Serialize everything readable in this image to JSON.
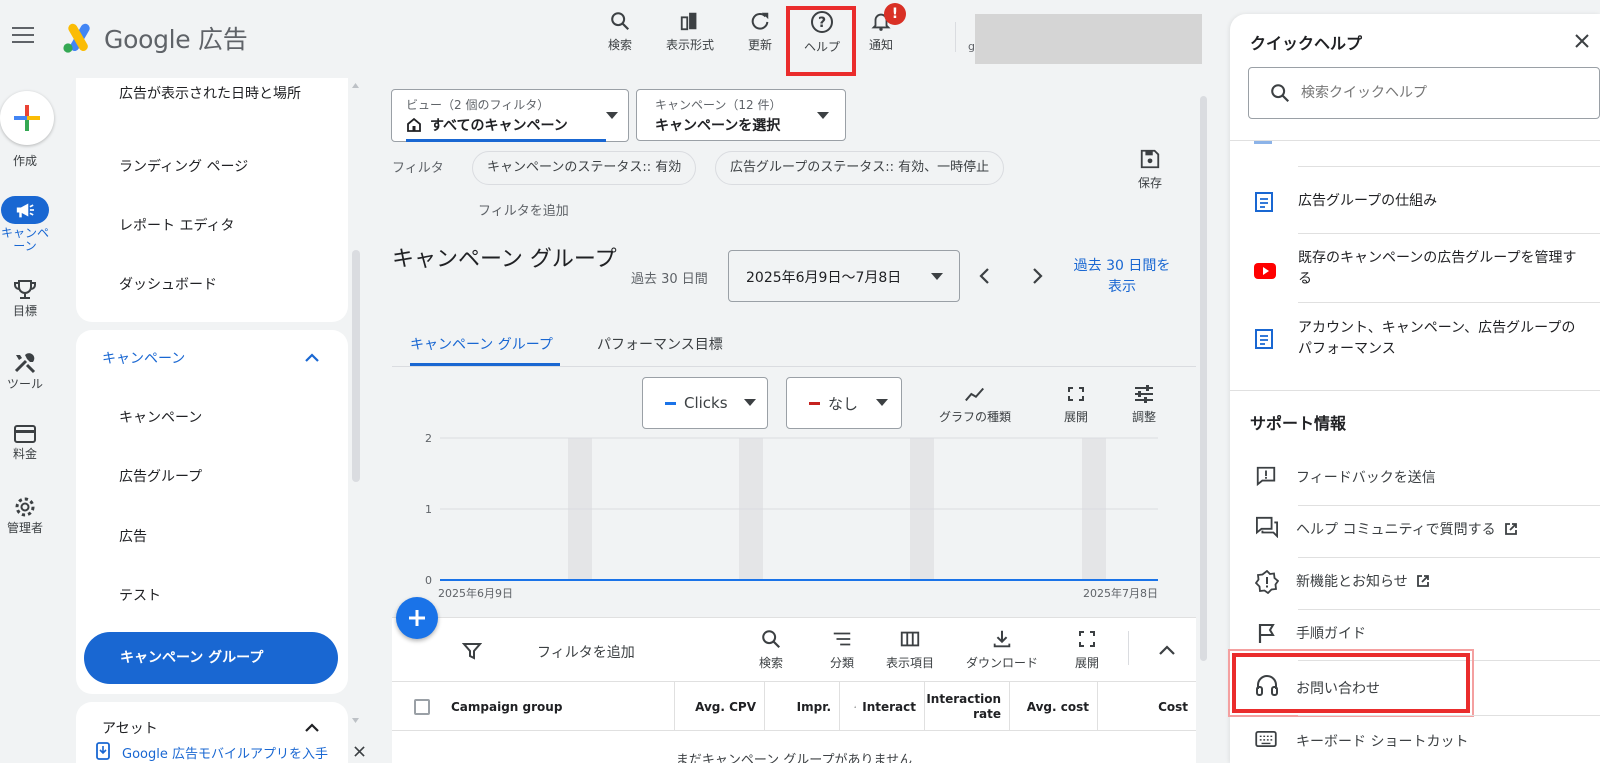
{
  "header": {
    "app_name": "Google 広告",
    "tools": [
      {
        "label": "検索",
        "icon": "search-icon"
      },
      {
        "label": "表示形式",
        "icon": "appearance-icon"
      },
      {
        "label": "更新",
        "icon": "refresh-icon"
      },
      {
        "label": "ヘルプ",
        "icon": "help-icon"
      },
      {
        "label": "通知",
        "icon": "bell-icon"
      }
    ],
    "notification_badge": "!",
    "account_initial": "g"
  },
  "rail": {
    "create_label": "作成",
    "items": [
      {
        "label": "キャンペーン",
        "icon": "megaphone-icon"
      },
      {
        "label": "目標",
        "icon": "trophy-icon"
      },
      {
        "label": "ツール",
        "icon": "tools-icon"
      },
      {
        "label": "料金",
        "icon": "credit-card-icon"
      },
      {
        "label": "管理者",
        "icon": "gear-icon"
      }
    ]
  },
  "nav": {
    "top_items": [
      "広告が表示された日時と場所",
      "ランディング ページ",
      "レポート エディタ",
      "ダッシュボード"
    ],
    "campaign_section": "キャンペーン",
    "campaign_items": [
      "キャンペーン",
      "広告グループ",
      "広告",
      "テスト"
    ],
    "selected_item": "キャンペーン グループ",
    "assets_section": "アセット",
    "mobile_app_text": "Google 広告モバイルアプリを入手"
  },
  "main": {
    "view_selector": {
      "small": "ビュー（2 個のフィルタ）",
      "main": "すべてのキャンペーン"
    },
    "campaign_selector": {
      "small": "キャンペーン（12 件）",
      "main": "キャンペーンを選択"
    },
    "filter_label": "フィルタ",
    "chips": [
      "キャンペーンのステータス:: 有効",
      "広告グループのステータス:: 有効、一時停止"
    ],
    "add_filter": "フィルタを追加",
    "save_label": "保存",
    "page_title": "キャンペーン グループ",
    "period_label": "過去 30 日間",
    "date_range": "2025年6月9日〜7月8日",
    "show_last_30": "過去 30 日間を表示",
    "tabs": [
      "キャンペーン グループ",
      "パフォーマンス目標"
    ]
  },
  "chart": {
    "metric1": "Clicks",
    "metric1_color": "#1a73e8",
    "metric2": "なし",
    "metric2_color": "#c5221f",
    "tools": [
      "グラフの種類",
      "展開",
      "調整"
    ]
  },
  "chart_data": {
    "type": "line",
    "x_labels": [
      "2025年6月9日",
      "2025年7月8日"
    ],
    "y_ticks": [
      "2",
      "1",
      "0"
    ],
    "ylim": [
      0,
      2
    ],
    "series": [
      {
        "name": "Clicks",
        "values": [
          0,
          0
        ]
      }
    ]
  },
  "table": {
    "toolbar_filter": "フィルタを追加",
    "tools": [
      "検索",
      "分類",
      "表示項目",
      "ダウンロード",
      "展開"
    ],
    "columns": [
      "Campaign group",
      "Avg. CPV",
      "Impr.",
      "Interact",
      "Interaction rate",
      "Avg. cost",
      "Cost"
    ],
    "empty_message": "まだキャンペーン グループがありません"
  },
  "quick_help": {
    "title": "クイックヘルプ",
    "search_placeholder": "検索クイックヘルプ",
    "articles": [
      {
        "text": "広告グループの仕組み",
        "icon": "article-icon"
      },
      {
        "text": "既存のキャンペーンの広告グループを管理する",
        "icon": "youtube-icon"
      },
      {
        "text": "アカウント、キャンペーン、広告グループのパフォーマンス",
        "icon": "article-icon"
      }
    ],
    "support_title": "サポート情報",
    "support_items": [
      {
        "text": "フィードバックを送信",
        "icon": "feedback-icon"
      },
      {
        "text": "ヘルプ コミュニティで質問する",
        "icon": "forum-icon"
      },
      {
        "text": "新機能とお知らせ",
        "icon": "new-releases-icon"
      },
      {
        "text": "手順ガイド",
        "icon": "flag-icon"
      },
      {
        "text": "お問い合わせ",
        "icon": "headset-icon"
      },
      {
        "text": "キーボード ショートカット",
        "icon": "keyboard-icon"
      }
    ]
  }
}
